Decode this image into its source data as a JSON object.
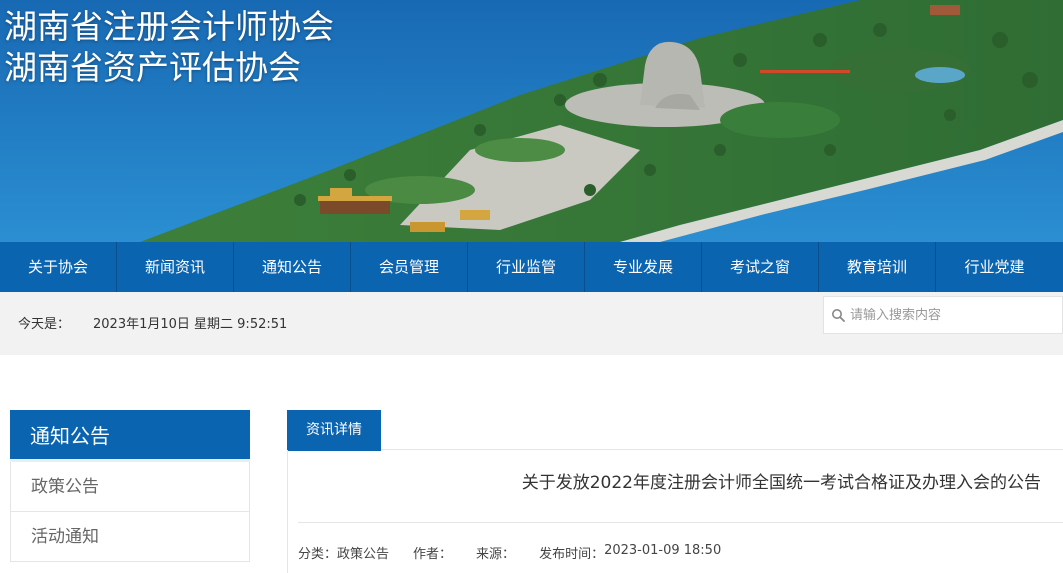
{
  "header": {
    "title_line1": "湖南省注册会计师协会",
    "title_line2": "湖南省资产评估协会"
  },
  "nav": {
    "items": [
      "关于协会",
      "新闻资讯",
      "通知公告",
      "会员管理",
      "行业监管",
      "专业发展",
      "考试之窗",
      "教育培训",
      "行业党建"
    ]
  },
  "datebar": {
    "label": "今天是：",
    "value": "2023年1月10日 星期二 9:52:51"
  },
  "search": {
    "placeholder": "请输入搜索内容"
  },
  "sidebar": {
    "heading": "通知公告",
    "items": [
      "政策公告",
      "活动通知"
    ]
  },
  "content": {
    "tab_label": "资讯详情",
    "article_title": "关于发放2022年度注册会计师全国统一考试合格证及办理入会的公告",
    "meta": {
      "category_label": "分类：",
      "category_value": "政策公告",
      "author_label": "作者：",
      "source_label": "来源：",
      "published_label": "发布时间：",
      "published_value": "2023-01-09 18:50"
    }
  },
  "colors": {
    "brand_blue": "#0b64b0",
    "bar_gray": "#f2f2f2"
  }
}
